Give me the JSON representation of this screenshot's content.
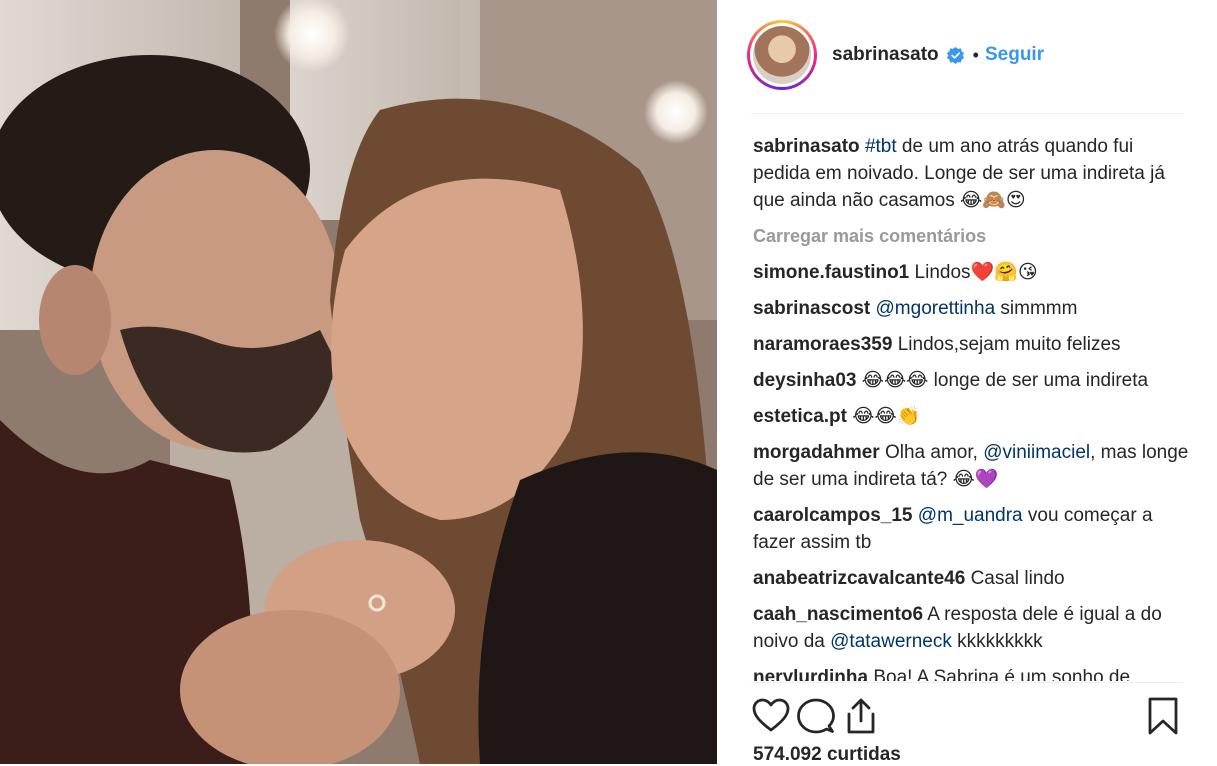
{
  "post": {
    "username": "sabrinasato",
    "dot": "•",
    "follow_label": "Seguir",
    "caption": {
      "user": "sabrinasato",
      "hashtag": "#tbt",
      "text": "de um ano atrás quando fui pedida em noivado. Longe de ser uma indireta já que ainda não casamos 😂🙈😍"
    },
    "load_more": "Carregar mais comentários",
    "comments": [
      {
        "user": "simone.faustino1",
        "pre": "",
        "mention": "",
        "text": "Lindos❤️🤗😘"
      },
      {
        "user": "sabrinascost",
        "pre": "",
        "mention": "@mgorettinha",
        "text": "simmmm"
      },
      {
        "user": "naramoraes359",
        "pre": "",
        "mention": "",
        "text": "Lindos,sejam muito felizes"
      },
      {
        "user": "deysinha03",
        "pre": "",
        "mention": "",
        "text": "😂😂😂 longe de ser uma indireta"
      },
      {
        "user": "estetica.pt",
        "pre": "",
        "mention": "",
        "text": "😂😂👏"
      },
      {
        "user": "morgadahmer",
        "pre": "Olha amor,",
        "mention": "@viniimaciel",
        "text": ", mas longe de ser uma indireta tá? 😂💜"
      },
      {
        "user": "caarolcampos_15",
        "pre": "",
        "mention": "@m_uandra",
        "text": "vou começar a fazer assim tb"
      },
      {
        "user": "anabeatrizcavalcante46",
        "pre": "",
        "mention": "",
        "text": "Casal lindo"
      },
      {
        "user": "caah_nascimento6",
        "pre": "A resposta dele é igual a do noivo da",
        "mention": "@tatawerneck",
        "text": "kkkkkkkkk"
      },
      {
        "user": "nerylurdinha",
        "pre": "",
        "mention": "",
        "text": "Boa! A Sabrina é um sonho de"
      }
    ],
    "likes": "574.092 curtidas"
  },
  "icons": {
    "avatar": "profile-photo",
    "verified": "verified-badge-icon",
    "like": "heart-icon",
    "comment": "comment-bubble-icon",
    "share": "share-icon",
    "save": "bookmark-icon"
  },
  "colors": {
    "link": "#3897f0",
    "mention": "#003569",
    "muted": "#999999",
    "text": "#262626"
  }
}
